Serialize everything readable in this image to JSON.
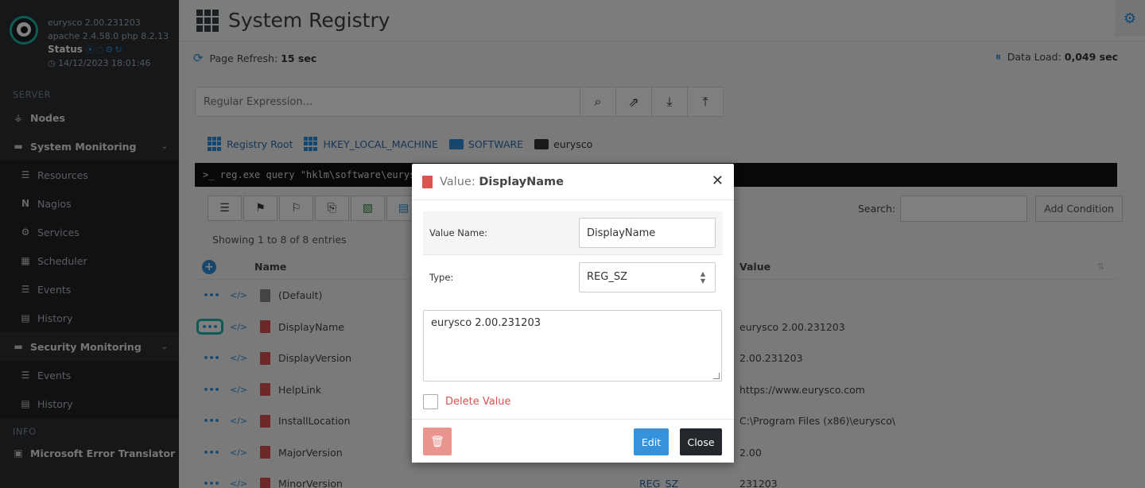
{
  "brand": {
    "app_version": "eurysco 2.00.231203",
    "server_info": "apache 2.4.58.0  php 8.2.13",
    "status_label": "Status",
    "timestamp": "14/12/2023 18:01:46"
  },
  "sidebar": {
    "server_section": "SERVER",
    "info_section": "INFO",
    "items": [
      {
        "label": "Nodes",
        "icon": "sitemap-icon"
      },
      {
        "label": "System Monitoring",
        "icon": "monitor-icon"
      },
      {
        "label": "Resources",
        "icon": "list-icon"
      },
      {
        "label": "Nagios",
        "icon": "nagios-icon"
      },
      {
        "label": "Services",
        "icon": "cog-icon"
      },
      {
        "label": "Scheduler",
        "icon": "calendar-icon"
      },
      {
        "label": "Events",
        "icon": "list-icon"
      },
      {
        "label": "History",
        "icon": "book-icon"
      },
      {
        "label": "Security Monitoring",
        "icon": "monitor-icon"
      },
      {
        "label": "Events",
        "icon": "list-icon"
      },
      {
        "label": "History",
        "icon": "book-icon"
      },
      {
        "label": "Microsoft Error Translator",
        "icon": "translate-icon"
      }
    ]
  },
  "header": {
    "title": "System Registry"
  },
  "info": {
    "refresh_label": "Page Refresh:",
    "refresh_value": "15 sec",
    "load_label": "Data Load:",
    "load_value": "0,049 sec"
  },
  "search": {
    "placeholder": "Regular Expression..."
  },
  "breadcrumb": {
    "items": [
      "Registry Root",
      "HKEY_LOCAL_MACHINE",
      "SOFTWARE",
      "eurysco"
    ]
  },
  "terminal": {
    "command": ">_  reg.exe query \"hklm\\software\\eurysco\""
  },
  "table_controls": {
    "search_label": "Search:",
    "add_condition": "Add Condition",
    "entries": "Showing 1 to 8 of 8 entries"
  },
  "table": {
    "columns": [
      "Name",
      "Value"
    ],
    "rows": [
      {
        "name": "(Default)",
        "type": "",
        "value": ""
      },
      {
        "name": "DisplayName",
        "type": "",
        "value": "eurysco 2.00.231203"
      },
      {
        "name": "DisplayVersion",
        "type": "",
        "value": "2.00.231203"
      },
      {
        "name": "HelpLink",
        "type": "",
        "value": "https://www.eurysco.com"
      },
      {
        "name": "InstallLocation",
        "type": "",
        "value": "C:\\Program Files (x86)\\eurysco\\"
      },
      {
        "name": "MajorVersion",
        "type": "",
        "value": "2.00"
      },
      {
        "name": "MinorVersion",
        "type": "REG_SZ",
        "value": "231203"
      }
    ]
  },
  "modal": {
    "title_prefix": "Value:",
    "title_name": "DisplayName",
    "value_name_label": "Value Name:",
    "value_name": "DisplayName",
    "type_label": "Type:",
    "type_value": "REG_SZ",
    "data_value": "eurysco 2.00.231203",
    "delete_label": "Delete Value",
    "edit_label": "Edit",
    "close_label": "Close"
  },
  "colors": {
    "accent": "#2f8fd8",
    "danger": "#d9534f",
    "sidebar": "#2b2f33",
    "highlight": "#1fb6a8"
  }
}
